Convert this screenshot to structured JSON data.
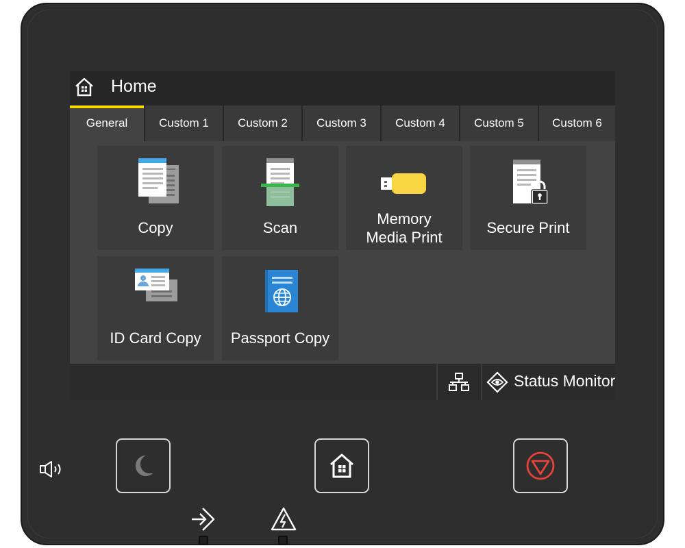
{
  "screen": {
    "title": "Home",
    "tabs": [
      {
        "label": "General",
        "active": true
      },
      {
        "label": "Custom 1"
      },
      {
        "label": "Custom 2"
      },
      {
        "label": "Custom 3"
      },
      {
        "label": "Custom 4"
      },
      {
        "label": "Custom 5"
      },
      {
        "label": "Custom 6"
      }
    ],
    "tiles": [
      {
        "label": "Copy",
        "icon": "copy-icon"
      },
      {
        "label": "Scan",
        "icon": "scan-icon"
      },
      {
        "label_line1": "Memory",
        "label_line2": "Media Print",
        "icon": "usb-memory-icon"
      },
      {
        "label": "Secure Print",
        "icon": "secure-print-icon"
      },
      {
        "label": "ID Card Copy",
        "icon": "id-card-icon"
      },
      {
        "label": "Passport Copy",
        "icon": "passport-icon"
      }
    ],
    "status": {
      "network_icon": "network-icon",
      "status_monitor_label": "Status Monitor",
      "status_icon": "eye-icon"
    }
  },
  "hardware": {
    "volume_icon": "speaker-icon",
    "sleep_icon": "moon-icon",
    "home_icon": "home-icon",
    "stop_icon": "stop-icon",
    "data_led_icon": "data-arrow-icon",
    "error_led_icon": "warning-icon"
  },
  "colors": {
    "active_tab_accent": "#f5d800",
    "stop_red": "#e8423a"
  }
}
